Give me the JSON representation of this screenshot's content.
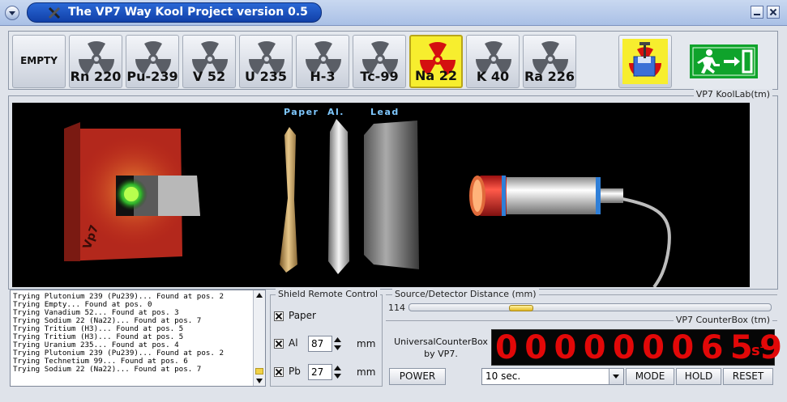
{
  "window": {
    "title": "The VP7 Way Kool Project version 0.5"
  },
  "toolbar": {
    "sources": [
      {
        "label": "EMPTY",
        "active": false,
        "empty": true
      },
      {
        "label": "Rn 220",
        "active": false
      },
      {
        "label": "Pu-239",
        "active": false
      },
      {
        "label": "V 52",
        "active": false
      },
      {
        "label": "U 235",
        "active": false
      },
      {
        "label": "H-3",
        "active": false
      },
      {
        "label": "Tc-99",
        "active": false
      },
      {
        "label": "Na 22",
        "active": true
      },
      {
        "label": "K 40",
        "active": false
      },
      {
        "label": "Ra 226",
        "active": false
      }
    ],
    "save_icon": "radiation-disk-save-icon",
    "exit_icon": "emergency-exit-icon"
  },
  "lab": {
    "title": "VP7 KoolLab(tm)",
    "paper_label": "Paper",
    "al_label": "Al.",
    "lead_label": "Lead"
  },
  "log": {
    "lines": [
      "Trying Plutonium 239 (Pu239)... Found at pos. 2",
      "Trying Empty... Found at pos. 0",
      "Trying Vanadium 52... Found at pos. 3",
      "Trying Sodium 22 (Na22)... Found at pos. 7",
      "Trying Tritium (H3)... Found at pos. 5",
      "Trying Tritium (H3)... Found at pos. 5",
      "Trying Uranium 235... Found at pos. 4",
      "Trying Plutonium 239 (Pu239)... Found at pos. 2",
      "Trying Technetium 99... Found at pos. 6",
      "Trying Sodium 22 (Na22)... Found at pos. 7"
    ]
  },
  "shield": {
    "title": "Shield Remote Control",
    "paper_label": "Paper",
    "al_label": "Al",
    "al_value": "87",
    "pb_label": "Pb",
    "pb_value": "27",
    "unit": "mm"
  },
  "distance": {
    "title": "Source/Detector Distance (mm)",
    "value": "114",
    "slider_fraction": 0.3
  },
  "counter": {
    "title": "VP7 CounterBox (tm)",
    "brand_line1": "UniversalCounterBox",
    "brand_line2": "by VP7.",
    "digits": "0000000659",
    "unit": "s",
    "unit_exp": "-1",
    "power_label": "POWER",
    "time_value": "10 sec.",
    "mode_label": "MODE",
    "hold_label": "HOLD",
    "reset_label": "RESET"
  },
  "colors": {
    "accent": "#1140a8",
    "display_red": "#e20808",
    "active_source": "#f7ee2e"
  }
}
